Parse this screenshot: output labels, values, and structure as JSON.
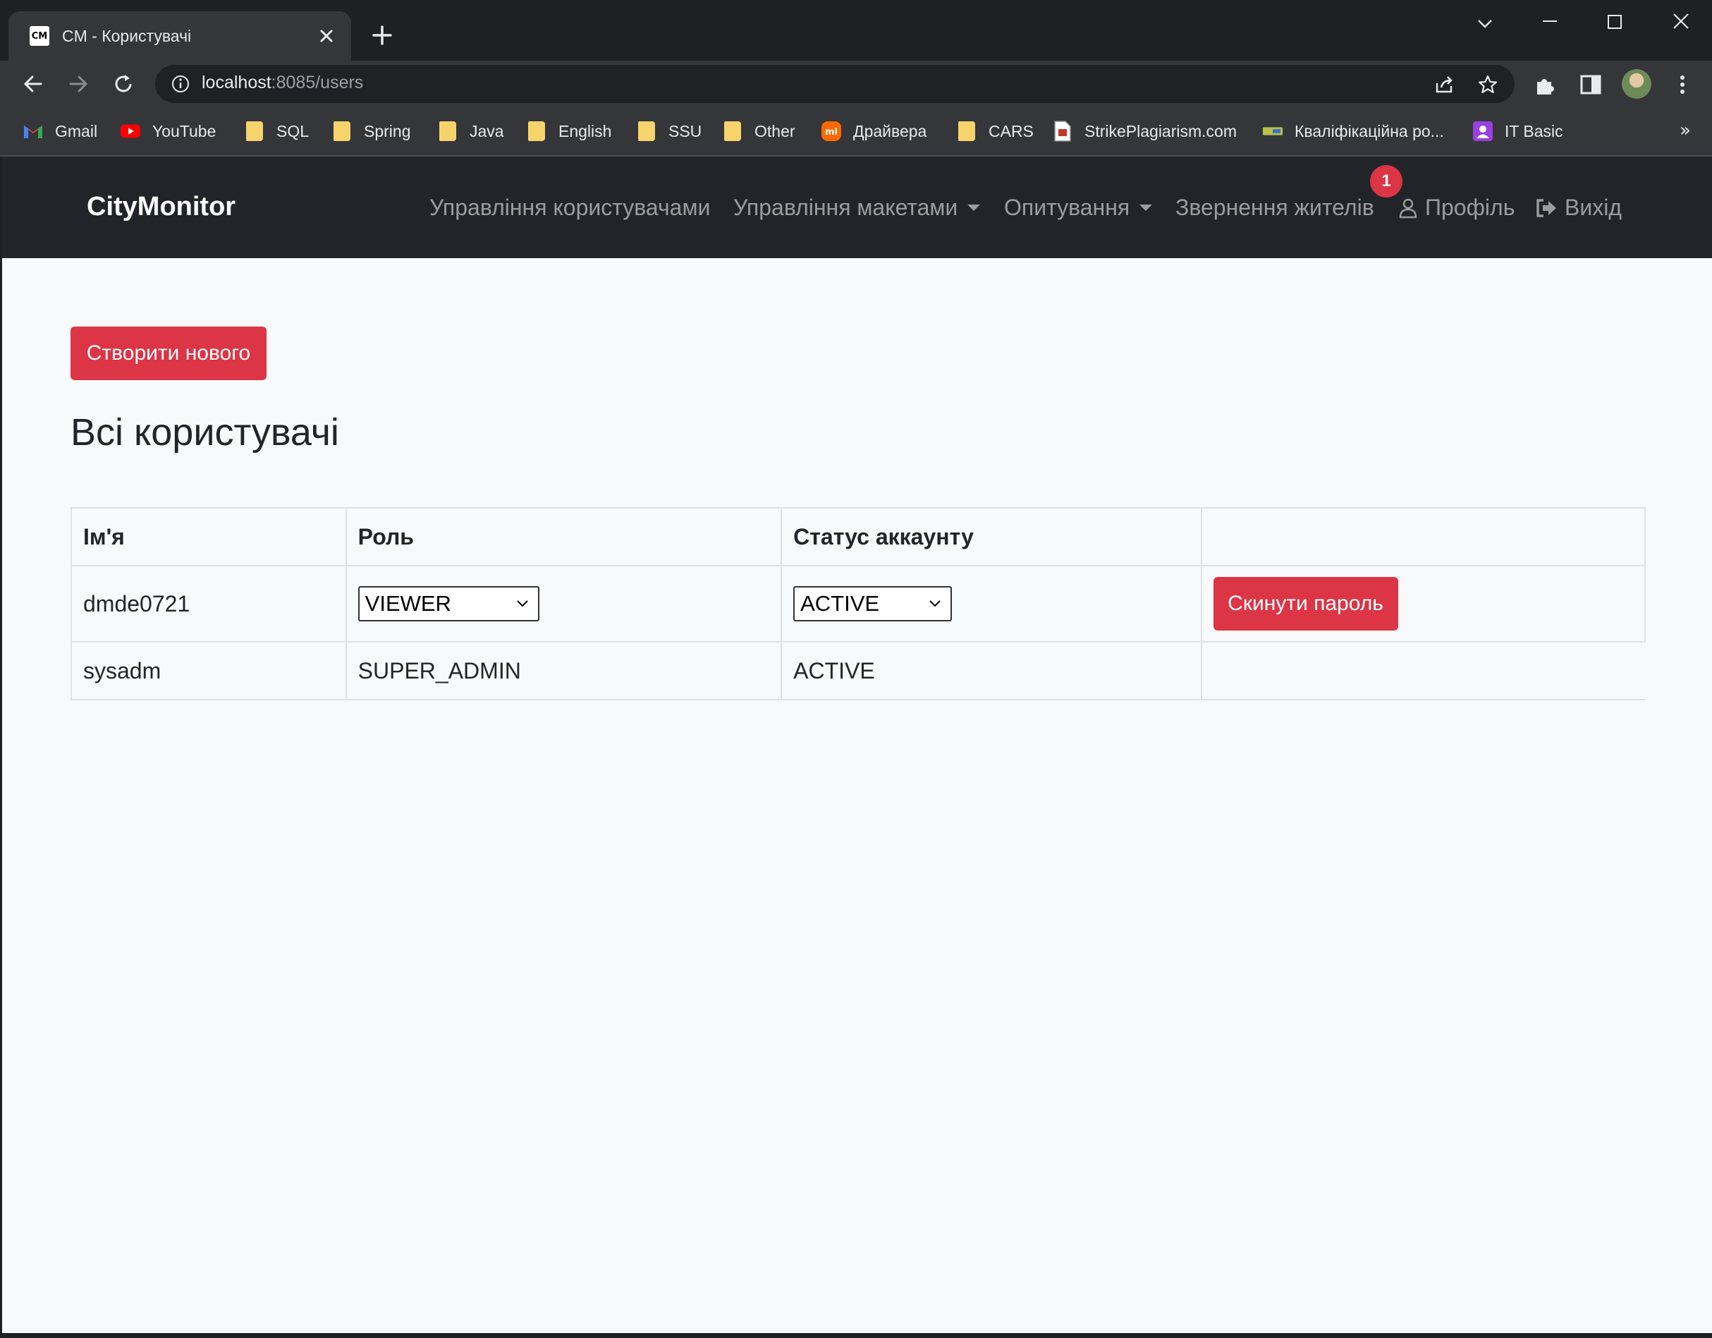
{
  "browser": {
    "tab_favicon": "CM",
    "tab_title": "CM - Користувачі",
    "url_host": "localhost",
    "url_path": ":8085/users"
  },
  "bookmarks": [
    {
      "label": "Gmail",
      "icon": "gmail-icon"
    },
    {
      "label": "YouTube",
      "icon": "youtube-icon"
    },
    {
      "label": "SQL",
      "icon": "folder-icon"
    },
    {
      "label": "Spring",
      "icon": "folder-icon"
    },
    {
      "label": "Java",
      "icon": "folder-icon"
    },
    {
      "label": "English",
      "icon": "folder-icon"
    },
    {
      "label": "SSU",
      "icon": "folder-icon"
    },
    {
      "label": "Other",
      "icon": "folder-icon"
    },
    {
      "label": "Драйвера",
      "icon": "mi-icon"
    },
    {
      "label": "CARS",
      "icon": "folder-icon"
    },
    {
      "label": "StrikePlagiarism.com",
      "icon": "document-icon"
    },
    {
      "label": "Кваліфікаційна ро...",
      "icon": "card-icon"
    },
    {
      "label": "IT Basic",
      "icon": "user-card-icon"
    }
  ],
  "bookmarks_more": "»",
  "navbar": {
    "brand": "CityMonitor",
    "items": [
      {
        "label": "Управління користувачами"
      },
      {
        "label": "Управління макетами"
      },
      {
        "label": "Опитування"
      },
      {
        "label": "Звернення жителів"
      },
      {
        "label": "Профіль"
      },
      {
        "label": "Вихід"
      }
    ],
    "badge": "1"
  },
  "main": {
    "create_button": "Створити нового",
    "title": "Всі користувачі",
    "table": {
      "headers": [
        "Ім'я",
        "Роль",
        "Статус аккаунту",
        ""
      ],
      "rows": [
        {
          "name": "dmde0721",
          "role": "VIEWER",
          "status": "ACTIVE",
          "action": "Скинути пароль"
        },
        {
          "name": "sysadm",
          "role": "SUPER_ADMIN",
          "status": "ACTIVE",
          "action": ""
        }
      ]
    }
  },
  "colors": {
    "navbar_bg": "#212529",
    "danger": "#dc3545",
    "page_bg": "#f8f9fa"
  }
}
